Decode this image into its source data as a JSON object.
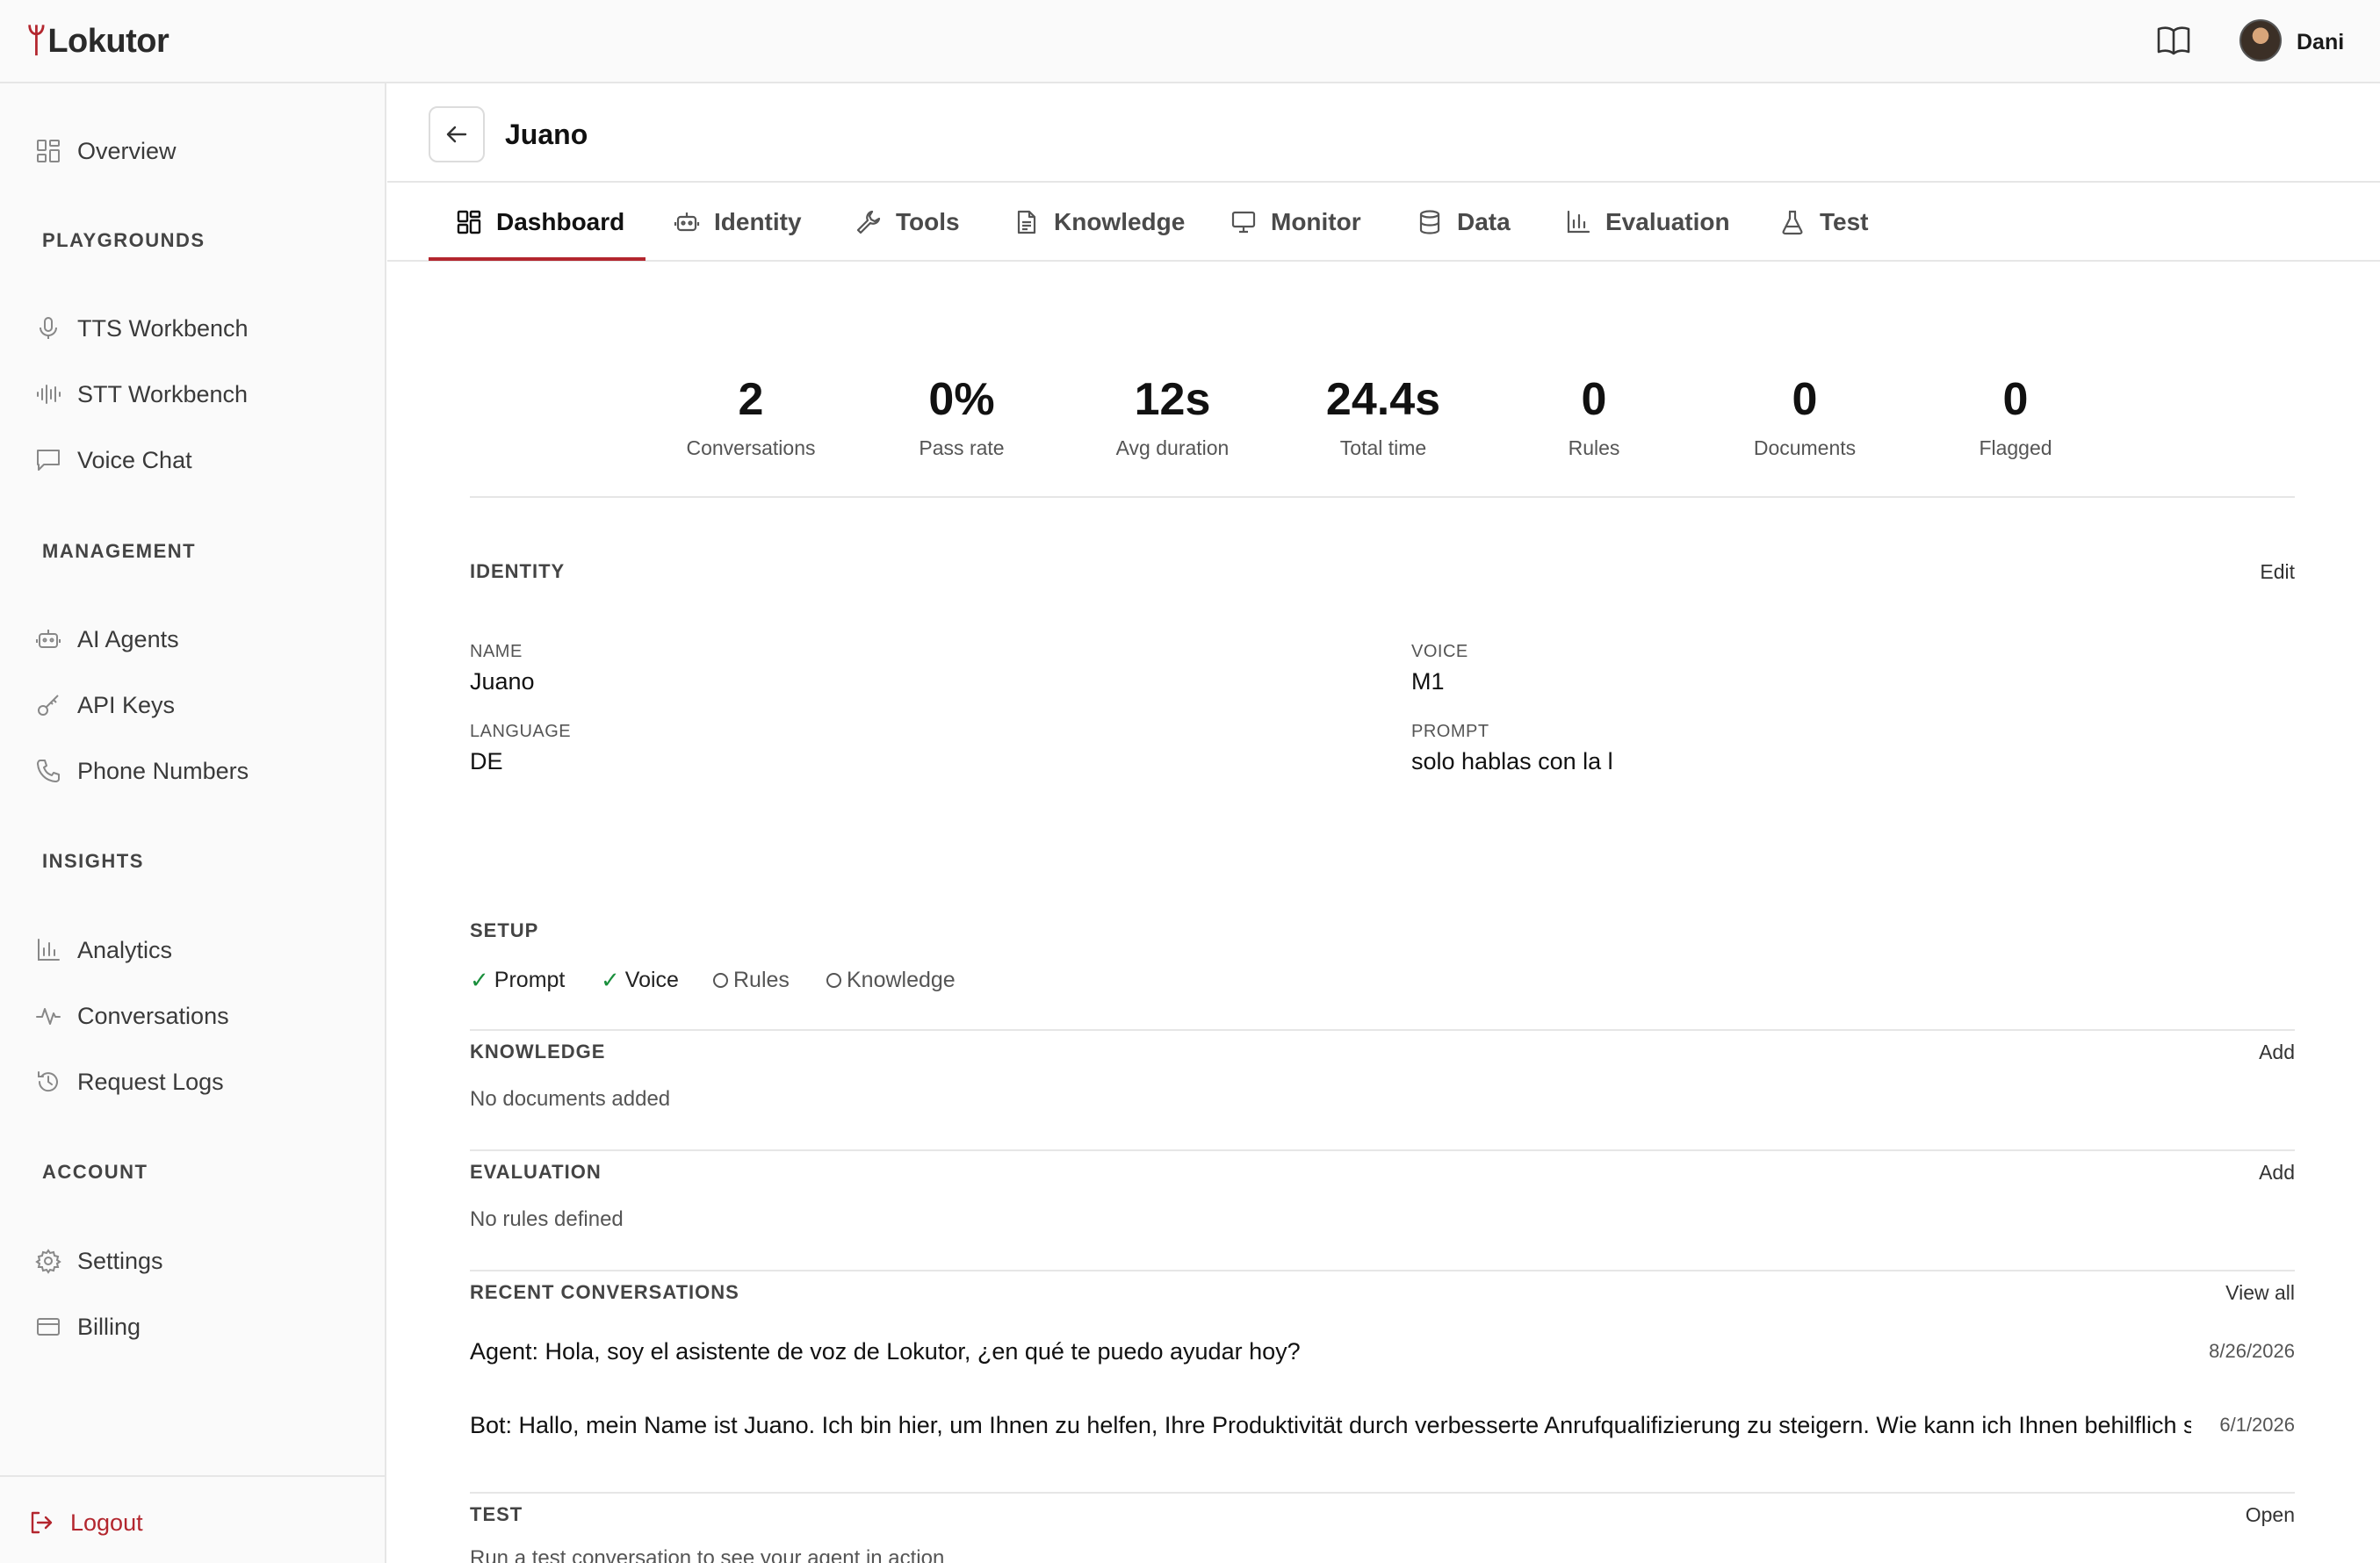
{
  "brand": {
    "logo_mark": "ᛘ",
    "logo_text": "Lokutor"
  },
  "topbar": {
    "user_name": "Dani"
  },
  "sidebar": {
    "overview": "Overview",
    "sections": {
      "playgrounds": "PLAYGROUNDS",
      "management": "MANAGEMENT",
      "insights": "INSIGHTS",
      "account": "ACCOUNT"
    },
    "items": {
      "tts": "TTS Workbench",
      "stt": "STT Workbench",
      "voice_chat": "Voice Chat",
      "ai_agents": "AI Agents",
      "api_keys": "API Keys",
      "phone_numbers": "Phone Numbers",
      "analytics": "Analytics",
      "conversations": "Conversations",
      "request_logs": "Request Logs",
      "settings": "Settings",
      "billing": "Billing"
    },
    "logout": "Logout"
  },
  "agent": {
    "title": "Juano"
  },
  "tabs": [
    {
      "label": "Dashboard",
      "icon": "dashboard-icon",
      "active": true
    },
    {
      "label": "Identity",
      "icon": "robot-icon"
    },
    {
      "label": "Tools",
      "icon": "wrench-icon"
    },
    {
      "label": "Knowledge",
      "icon": "document-icon"
    },
    {
      "label": "Monitor",
      "icon": "monitor-icon"
    },
    {
      "label": "Data",
      "icon": "database-icon"
    },
    {
      "label": "Evaluation",
      "icon": "bar-chart-icon"
    },
    {
      "label": "Test",
      "icon": "flask-icon"
    }
  ],
  "stats": [
    {
      "value": "2",
      "label": "Conversations"
    },
    {
      "value": "0%",
      "label": "Pass rate"
    },
    {
      "value": "12s",
      "label": "Avg duration"
    },
    {
      "value": "24.4s",
      "label": "Total time"
    },
    {
      "value": "0",
      "label": "Rules"
    },
    {
      "value": "0",
      "label": "Documents"
    },
    {
      "value": "0",
      "label": "Flagged"
    }
  ],
  "identity": {
    "title": "IDENTITY",
    "edit": "Edit",
    "name_label": "NAME",
    "name": "Juano",
    "voice_label": "VOICE",
    "voice": "M1",
    "language_label": "LANGUAGE",
    "language": "DE",
    "prompt_label": "PROMPT",
    "prompt": "solo hablas con la l"
  },
  "setup": {
    "title": "SETUP",
    "items": [
      {
        "label": "Prompt",
        "done": true
      },
      {
        "label": "Voice",
        "done": true
      },
      {
        "label": "Rules",
        "done": false
      },
      {
        "label": "Knowledge",
        "done": false
      }
    ]
  },
  "knowledge": {
    "title": "KNOWLEDGE",
    "action": "Add",
    "empty": "No documents added"
  },
  "evaluation": {
    "title": "EVALUATION",
    "action": "Add",
    "empty": "No rules defined"
  },
  "recent": {
    "title": "RECENT CONVERSATIONS",
    "action": "View all",
    "items": [
      {
        "text": "Agent: Hola, soy el asistente de voz de Lokutor, ¿en qué te puedo ayudar hoy?",
        "date": "8/26/2026"
      },
      {
        "text": "Bot: Hallo, mein Name ist Juano. Ich bin hier, um Ihnen zu helfen, Ihre Produktivität durch verbesserte Anrufqualifizierung zu steigern. Wie kann ich Ihnen behilflich sein?",
        "date": "6/1/2026"
      }
    ]
  },
  "test": {
    "title": "TEST",
    "action": "Open",
    "description": "Run a test conversation to see your agent in action"
  }
}
